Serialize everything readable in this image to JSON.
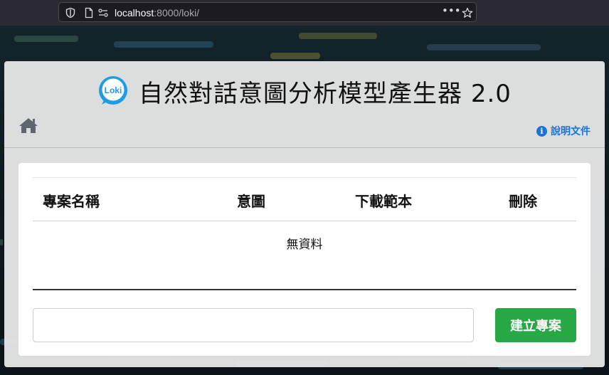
{
  "browser": {
    "url_host": "localhost",
    "url_rest": ":8000/loki/",
    "icons": [
      "shield-icon",
      "page-icon",
      "permissions-icon",
      "more-icon",
      "bookmark-star-icon"
    ]
  },
  "header": {
    "logo_text": "Loki",
    "title": "自然對話意圖分析模型產生器 2.0",
    "help_label": "說明文件",
    "help_icon_glyph": "i"
  },
  "table": {
    "columns": [
      "專案名稱",
      "意圖",
      "下載範本",
      "刪除"
    ],
    "empty_text": "無資料"
  },
  "form": {
    "input_value": "",
    "input_placeholder": "",
    "create_label": "建立專案"
  },
  "colors": {
    "accent_blue": "#1a73d9",
    "button_green": "#28a745",
    "logo_blue": "#1e9be6"
  }
}
